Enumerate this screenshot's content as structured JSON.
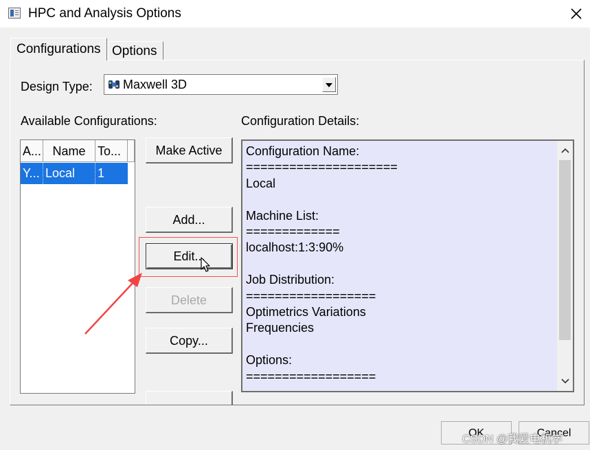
{
  "window": {
    "title": "HPC and Analysis Options",
    "close_label": "✕"
  },
  "tabs": [
    {
      "label": "Configurations",
      "selected": true
    },
    {
      "label": "Options",
      "selected": false
    }
  ],
  "design_type": {
    "label": "Design Type:",
    "value": "Maxwell 3D",
    "icon": "maxwell-3d-icon"
  },
  "available_configs": {
    "label": "Available Configurations:",
    "columns": [
      "A...",
      "Name",
      "To..."
    ],
    "rows": [
      {
        "active": "Y...",
        "name": "Local",
        "tasks": "1",
        "selected": true
      }
    ]
  },
  "buttons": {
    "make_active": "Make Active",
    "add": "Add...",
    "edit": "Edit...",
    "delete": "Delete",
    "copy": "Copy..."
  },
  "details": {
    "label": "Configuration Details:",
    "lines": [
      "Configuration Name:",
      "=====================",
      "Local",
      "",
      "Machine List:",
      "=============",
      "localhost:1:3:90%",
      "",
      "Job Distribution:",
      "==================",
      "Optimetrics Variations",
      "Frequencies",
      "",
      "Options:",
      "=================="
    ]
  },
  "footer": {
    "ok": "OK",
    "cancel": "Cancel"
  },
  "watermark": "CSDN @我爱电机学",
  "colors": {
    "selection": "#1a74e1",
    "details_bg": "#e6e6fa",
    "annotation": "#ff4a4a"
  }
}
